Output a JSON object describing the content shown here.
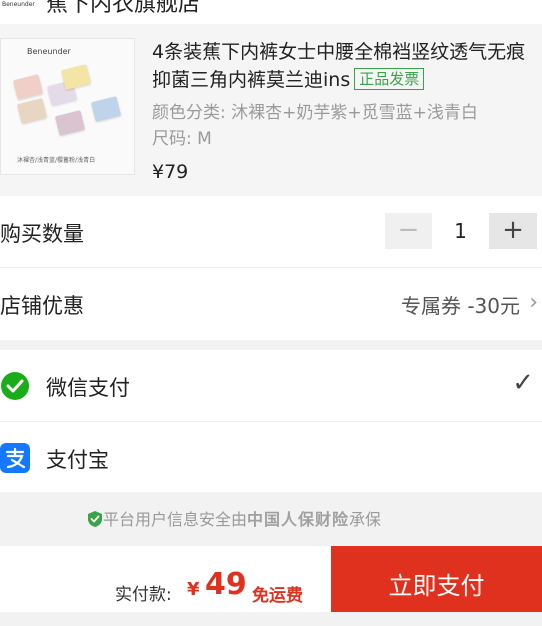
{
  "store": {
    "name": "蕉下内衣旗舰店",
    "logo_text": "蕉下 Beneunder"
  },
  "product": {
    "image_brand": "Beneunder",
    "image_caption": "沐裸杏/浅青蓝/樱蓄粉/浅青白",
    "title": "4条装蕉下内裤女士中腰全棉裆竖纹透气无痕抑菌三角内裤莫兰迪ins",
    "badge": "正品发票",
    "spec": "颜色分类: 沐裸杏+奶芋紫+觅雪蓝+浅青白",
    "size": "尺码: M",
    "price": "¥79"
  },
  "quantity": {
    "label": "购买数量",
    "minus": "−",
    "value": "1",
    "plus": "+"
  },
  "coupon": {
    "label": "店铺优惠",
    "value": "专属券 -30元",
    "chevron": "›"
  },
  "payment": {
    "wechat": {
      "label": "微信支付",
      "icon": "wechat-pay-icon",
      "selected": true,
      "check": "✓"
    },
    "alipay": {
      "label": "支付宝",
      "icon": "alipay-icon",
      "selected": false
    }
  },
  "security": {
    "prefix": "平台用户信息安全由",
    "insurer": "中国人保财险",
    "suffix": "承保"
  },
  "footer": {
    "total_label": "实付款:",
    "currency": "¥",
    "total": "49",
    "shipping": "免运费",
    "pay_button": "立即支付"
  },
  "colors": {
    "accent": "#e0301e",
    "green": "#3aa34a",
    "wechat": "#1aad19",
    "alipay": "#1678ff"
  }
}
